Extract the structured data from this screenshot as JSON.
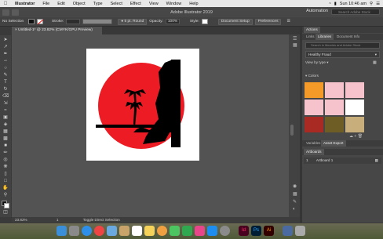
{
  "menubar": {
    "app": "Illustrator",
    "items": [
      "File",
      "Edit",
      "Object",
      "Type",
      "Select",
      "Effect",
      "View",
      "Window",
      "Help"
    ],
    "clock": "Sun 10:46 am"
  },
  "titlebar": {
    "title": "Adobe Illustrator 2019",
    "workspace": "Automation",
    "search_placeholder": "Search Adobe Stock"
  },
  "controlbar": {
    "selection": "No Selection",
    "stroke_label": "Stroke:",
    "brush": "5 pt. Round",
    "opacity_label": "Opacity:",
    "opacity_value": "100%",
    "style_label": "Style:",
    "doc_setup": "Document Setup",
    "preferences": "Preferences"
  },
  "document": {
    "tab": "Untitled-1* @ 23.82% (CMYK/GPU Preview)"
  },
  "statusbar": {
    "zoom": "23.82%",
    "artboard_no": "1",
    "tool": "Toggle Direct Selection"
  },
  "panels": {
    "actions_tab": "Actions",
    "links_tab": "Links",
    "libraries_tab": "Libraries",
    "docinfo_tab": "Document Info",
    "search_placeholder": "Search in libraries and Adobe Stock",
    "library": "Healthy Fraud",
    "view_by": "View by type",
    "colors_label": "Colors",
    "colors": [
      "#f49a28",
      "#f6c3cc",
      "#f6c3cc",
      "#f6c3cc",
      "#f6c3cc",
      "#ffffff",
      "#a82a22",
      "#6e5e26",
      "#c7ae7a"
    ],
    "variables_tab": "Variables",
    "asset_export_tab": "Asset Export",
    "artboards_tab": "Artboards",
    "artboard_row_no": "1",
    "artboard_row": "Artboard 1"
  },
  "colors": {
    "sun": "#ed1c24",
    "silhouette": "#000000"
  }
}
